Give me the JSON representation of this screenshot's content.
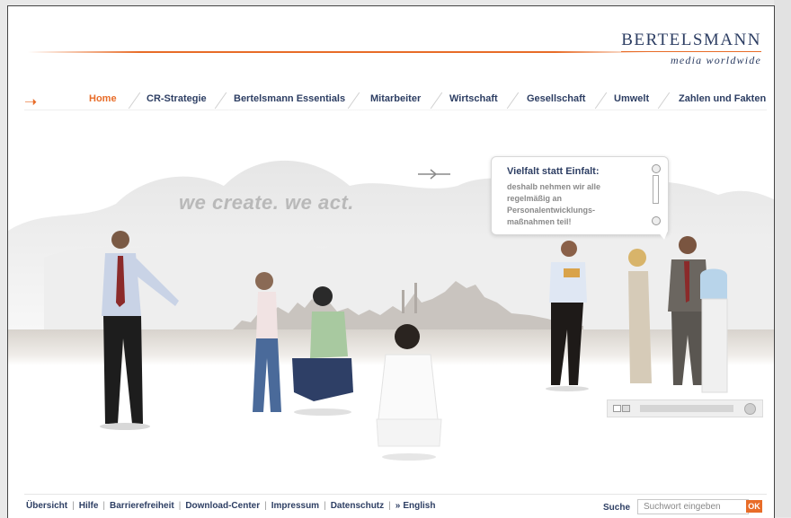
{
  "header": {
    "logo_name": "BERTELSMANN",
    "logo_tagline": "media worldwide"
  },
  "nav": {
    "items": [
      {
        "label": "Home",
        "active": true
      },
      {
        "label": "CR-Strategie"
      },
      {
        "label": "Bertelsmann Essentials"
      },
      {
        "label": "Mitarbeiter"
      },
      {
        "label": "Wirtschaft"
      },
      {
        "label": "Gesellschaft"
      },
      {
        "label": "Umwelt"
      },
      {
        "label": "Zahlen und Fakten"
      }
    ]
  },
  "hero": {
    "slogan": "we create. we act."
  },
  "infobox": {
    "title": "Vielfalt statt Einfalt:",
    "text": "deshalb nehmen wir alle regelmäßig an Personalentwicklungs-maßnahmen teil!"
  },
  "footer": {
    "links": [
      "Übersicht",
      "Hilfe",
      "Barrierefreiheit",
      "Download-Center",
      "Impressum",
      "Datenschutz"
    ],
    "language_link": "English",
    "search_label": "Suche",
    "search_placeholder": "Suchwort eingeben",
    "search_button": "OK"
  },
  "colors": {
    "accent": "#e86c28",
    "brand": "#2d3e63"
  }
}
